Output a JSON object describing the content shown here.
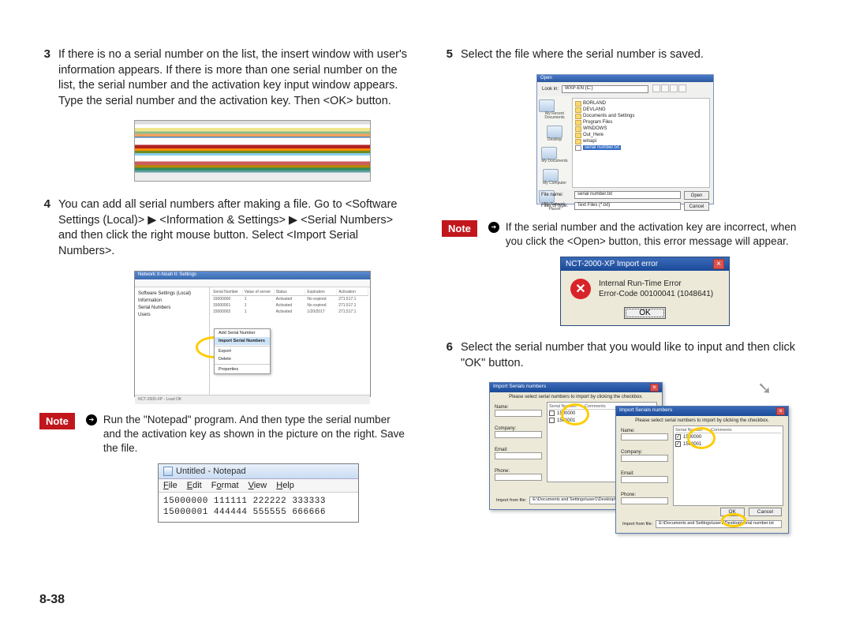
{
  "page_number": "8-38",
  "left": {
    "step3": {
      "num": "3",
      "text": "If there is no a serial number on the list, the insert window with user's information appears. If there is more than one serial number on the list, the serial number and the activation key input window appears. Type the serial number and the activation key. Then <OK> button."
    },
    "step4": {
      "num": "4",
      "text": "You can add all serial numbers after making a file. Go to <Software Settings (Local)> ▶ <Information & Settings> ▶ <Serial Numbers> and then click the right mouse button. Select <Import Serial Numbers>."
    },
    "settings_fig": {
      "title": "Network X-Noah II: Settings",
      "tree": [
        "Software Settings (Local)",
        "  Information",
        "  Serial Numbers",
        "  Users"
      ],
      "grid_head": [
        "Serial Number",
        "Value of server",
        "Status",
        "Expiration",
        "Activation"
      ],
      "grid_rows": [
        [
          "15000000",
          "1",
          "Activated",
          "No expired",
          "271.517.1"
        ],
        [
          "15000001",
          "1",
          "Activated",
          "No expired",
          "271.517.1"
        ],
        [
          "15000002",
          "1",
          "Activated",
          "1/20/2017",
          "271.517.1"
        ]
      ],
      "menu": [
        "Add Serial Number",
        "Import Serial Numbers",
        "Export",
        "Delete",
        "Properties"
      ],
      "status": "NCT-2000-XP - Load OK"
    },
    "note1": {
      "label": "Note",
      "text": "Run the \"Notepad\" program. And then type the serial number and the activation key as shown in the picture on the right. Save the file."
    },
    "notepad": {
      "title": "Untitled - Notepad",
      "menus": [
        "File",
        "Edit",
        "Format",
        "View",
        "Help"
      ],
      "line1": "15000000 111111 222222 333333",
      "line2": "15000001 444444 555555 666666"
    }
  },
  "right": {
    "step5": {
      "num": "5",
      "text": "Select the file where the serial number is saved."
    },
    "open_dialog": {
      "title": "Open",
      "lookin_label": "Look in:",
      "lookin_value": "WXP-EN (C:)",
      "side": [
        "My Recent Documents",
        "Desktop",
        "My Documents",
        "My Computer",
        "My Network Places"
      ],
      "files": [
        "BORLAND",
        "DEVLANG",
        "Documents and Settings",
        "Program Files",
        "WINDOWS",
        "Out_Here",
        "winapi"
      ],
      "selected_file": "serial number.txt",
      "filename_label": "File name:",
      "filename_value": "serial number.txt",
      "filetype_label": "Files of type:",
      "filetype_value": "Text Files (*.txt)",
      "open_btn": "Open",
      "cancel_btn": "Cancel"
    },
    "note2": {
      "label": "Note",
      "text": "If the serial number and the activation key are incorrect, when you click the <Open> button, this error message will appear."
    },
    "error_dialog": {
      "title": "NCT-2000-XP Import error",
      "line1": "Internal Run-Time Error",
      "line2": "Error-Code 00100041 (1048641)",
      "ok": "OK"
    },
    "step6": {
      "num": "6",
      "text": "Select the serial number that you would like to input and then click \"OK\" button."
    },
    "import_dialog": {
      "title": "Import Serials numbers",
      "instruction": "Please select serial numbers to import by clicking the checkbox.",
      "labels": [
        "Name:",
        "Company:",
        "Email:",
        "Phone:"
      ],
      "head": [
        "Serial Number",
        "Comments"
      ],
      "serials_unchecked": [
        "1500000",
        "1500001"
      ],
      "serials_checked": [
        "1500000",
        "1500001"
      ],
      "ok": "OK",
      "cancel": "Cancel",
      "path_label": "Import from file:",
      "path1": "E:\\Documents and Settings\\user1\\Desktop\\serial number.txt",
      "path2": "E:\\Documents and Settings\\user1\\Desktop\\serial number.txt"
    }
  }
}
